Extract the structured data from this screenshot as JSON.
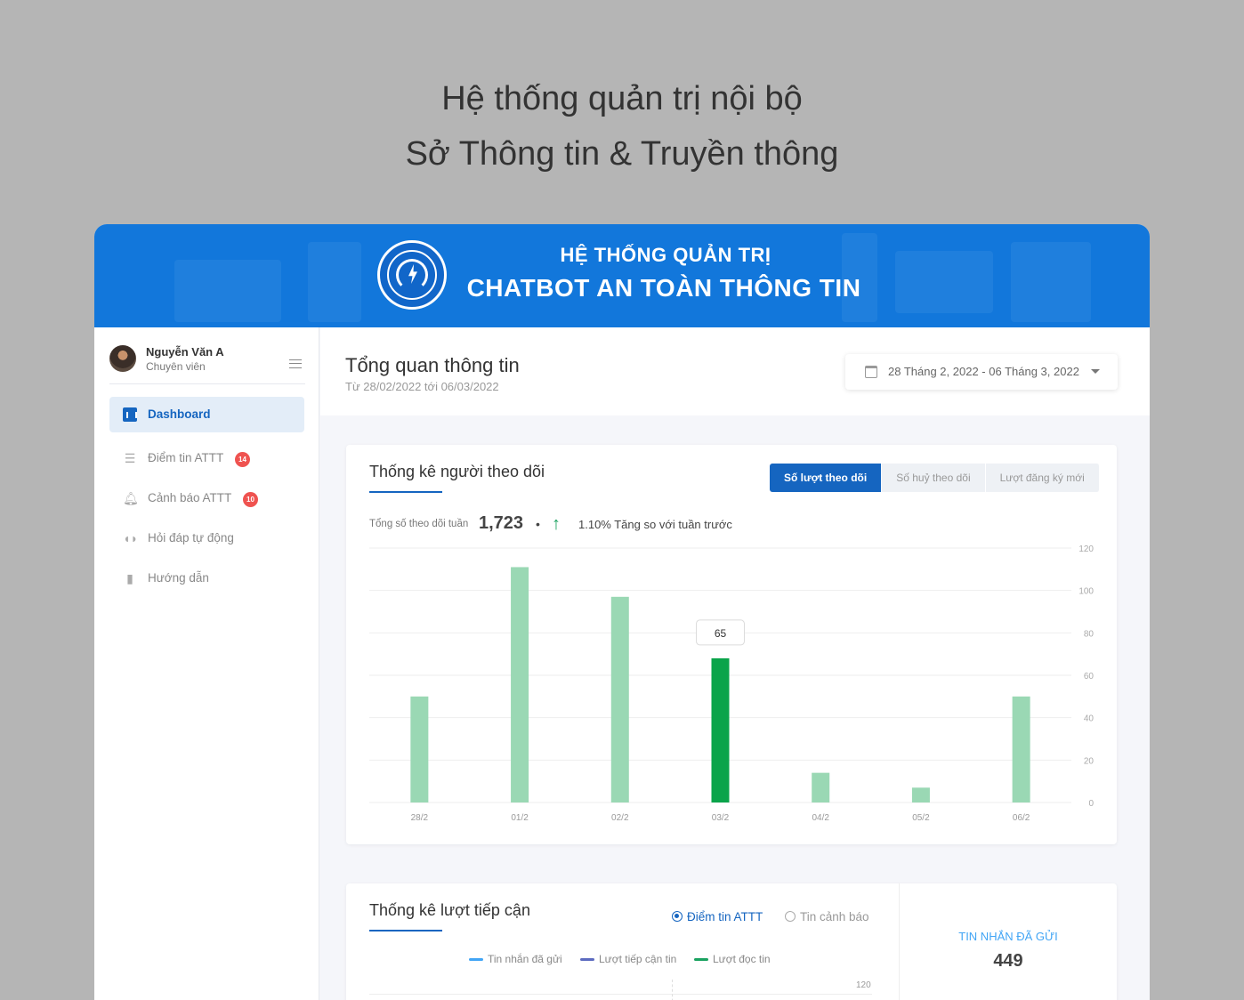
{
  "hero": {
    "line1": "Hệ thống quản trị nội bộ",
    "line2": "Sở Thông tin & Truyền thông"
  },
  "banner": {
    "title_top": "HỆ THỐNG QUẢN TRỊ",
    "title_main": "CHATBOT AN TOÀN THÔNG TIN",
    "logo_icon": "ministry-emblem-icon"
  },
  "user": {
    "name": "Nguyễn Văn A",
    "role": "Chuyên viên"
  },
  "sidebar": {
    "items": [
      {
        "label": "Dashboard",
        "icon": "chart-icon",
        "active": true
      },
      {
        "label": "Điểm tin ATTT",
        "icon": "list-icon",
        "badge": "14"
      },
      {
        "label": "Cảnh báo ATTT",
        "icon": "bell-icon",
        "badge": "10"
      },
      {
        "label": "Hỏi đáp tự động",
        "icon": "headset-icon"
      },
      {
        "label": "Hướng dẫn",
        "icon": "book-icon"
      }
    ]
  },
  "page": {
    "title": "Tổng quan thông tin",
    "subtitle": "Từ 28/02/2022 tới 06/03/2022",
    "date_range": "28 Tháng 2, 2022 - 06 Tháng 3, 2022"
  },
  "followers": {
    "title": "Thống kê người theo dõi",
    "tabs": [
      "Số lượt theo dõi",
      "Số huỷ theo dõi",
      "Lượt đăng ký mới"
    ],
    "active_tab": 0,
    "stat_label": "Tổng số theo dõi tuần",
    "stat_value": "1,723",
    "stat_dot": "•",
    "stat_arrow": "↑",
    "stat_change": "1.10% Tăng so với tuần trước",
    "tooltip": "65"
  },
  "reach": {
    "title": "Thống kê lượt tiếp cận",
    "radio_options": [
      "Điểm tin ATTT",
      "Tin cảnh báo"
    ],
    "selected": 0,
    "legend": [
      "Tin nhắn đã gửi",
      "Lượt tiếp cận tin",
      "Lượt đọc tin"
    ],
    "axis_top": "120",
    "side_label": "TIN NHẮN ĐÃ GỬI",
    "side_value": "449"
  },
  "colors": {
    "brand": "#1277db",
    "primary": "#1565c0",
    "bar": "#9ad8b4",
    "bar_highlight": "#0aa44a",
    "legend_sent": "#42a5f5",
    "legend_reach": "#5c6bc0",
    "legend_read": "#1aa260"
  },
  "chart_data": {
    "type": "bar",
    "categories": [
      "28/2",
      "01/2",
      "02/2",
      "03/2",
      "04/2",
      "05/2",
      "06/2"
    ],
    "values": [
      50,
      111,
      97,
      68,
      14,
      7,
      50
    ],
    "highlight_index": 3,
    "ylim": [
      0,
      120
    ],
    "yticks": [
      0,
      20,
      40,
      60,
      80,
      100,
      120
    ],
    "grid": true
  }
}
